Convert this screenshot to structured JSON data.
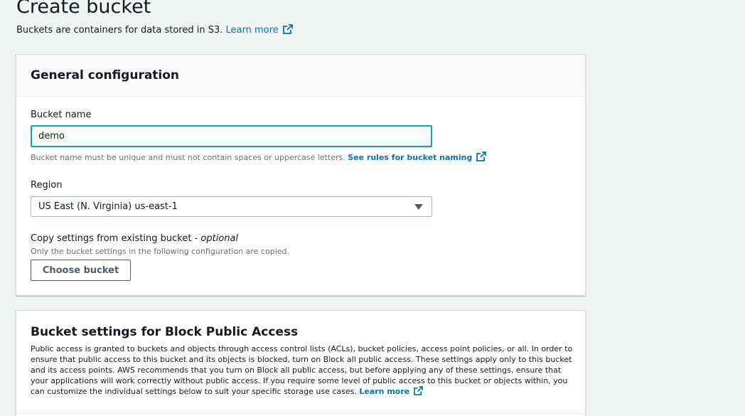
{
  "page": {
    "title": "Create bucket",
    "description": "Buckets are containers for data stored in S3.",
    "learn_more": "Learn more"
  },
  "general": {
    "title": "General configuration",
    "bucket_name": {
      "label": "Bucket name",
      "value": "demo",
      "hint": "Bucket name must be unique and must not contain spaces or uppercase letters.",
      "rules_link": "See rules for bucket naming"
    },
    "region": {
      "label": "Region",
      "selected": "US East (N. Virginia) us-east-1"
    },
    "copy_settings": {
      "label": "Copy settings from existing bucket - ",
      "optional": "optional",
      "hint": "Only the bucket settings in the following configuration are copied.",
      "button": "Choose bucket"
    }
  },
  "block_public_access": {
    "title": "Bucket settings for Block Public Access",
    "description": "Public access is granted to buckets and objects through access control lists (ACLs), bucket policies, access point policies, or all. In order to ensure that public access to this bucket and its objects is blocked, turn on Block all public access. These settings apply only to this bucket and its access points. AWS recommends that you turn on Block all public access, but before applying any of these settings, ensure that your applications will work correctly without public access. If you require some level of public access to this bucket or objects within, you can customize the individual settings below to suit your specific storage use cases.",
    "learn_more": "Learn more"
  },
  "colors": {
    "link": "#0073bb",
    "focus_border": "#0aa6b8",
    "page_bg": "#f2f3f3"
  }
}
